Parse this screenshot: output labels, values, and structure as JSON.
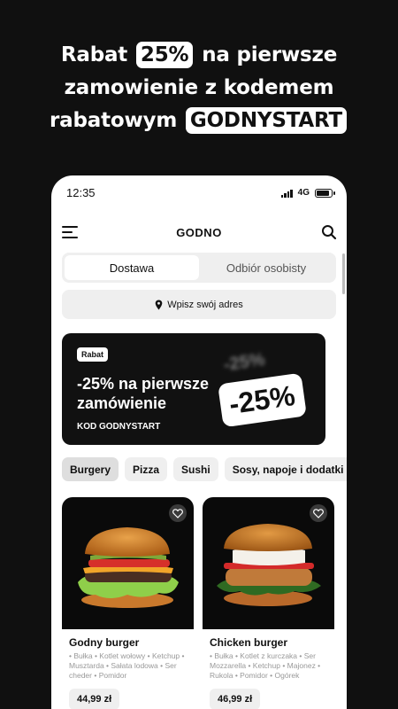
{
  "headline": {
    "line1_before": "Rabat",
    "line1_highlight": "25%",
    "line1_after": "na pierwsze",
    "line2": "zamowienie z kodemem",
    "line3_before": "rabatowym",
    "line3_highlight": "GODNYSTART"
  },
  "status_bar": {
    "time": "12:35",
    "network": "4G",
    "battery_level": 0.85
  },
  "header": {
    "brand": "GODNO",
    "menu_icon": "menu-icon",
    "search_icon": "search-icon"
  },
  "delivery_toggle": {
    "options": [
      "Dostawa",
      "Odbiór osobisty"
    ],
    "selected": "Dostawa"
  },
  "address": {
    "icon": "location-pin-icon",
    "label": "Wpisz swój adres"
  },
  "promo_banner": {
    "tag": "Rabat",
    "title": "-25% na pierwsze zamówienie",
    "code_text": "KOD GODNYSTART",
    "badge": "-25%",
    "badge_ghost": "-25%"
  },
  "categories": {
    "items": [
      "Burgery",
      "Pizza",
      "Sushi",
      "Sosy, napoje i dodatki"
    ],
    "selected": "Burgery"
  },
  "products": [
    {
      "name": "Godny burger",
      "description": "• Bułka • Kotlet wołowy • Ketchup • Musztarda • Sałata lodowa • Ser cheder • Pomidor",
      "price": "44,99 zł",
      "favorite_icon": "heart-icon"
    },
    {
      "name": "Chicken burger",
      "description": "• Bułka • Kotlet z kurczaka • Ser Mozzarella • Ketchup • Majonez • Rukola • Pomidor • Ogórek",
      "price": "46,99 zł",
      "favorite_icon": "heart-icon"
    }
  ],
  "colors": {
    "background": "#101010",
    "accent": "#111111",
    "surface": "#efefef"
  }
}
